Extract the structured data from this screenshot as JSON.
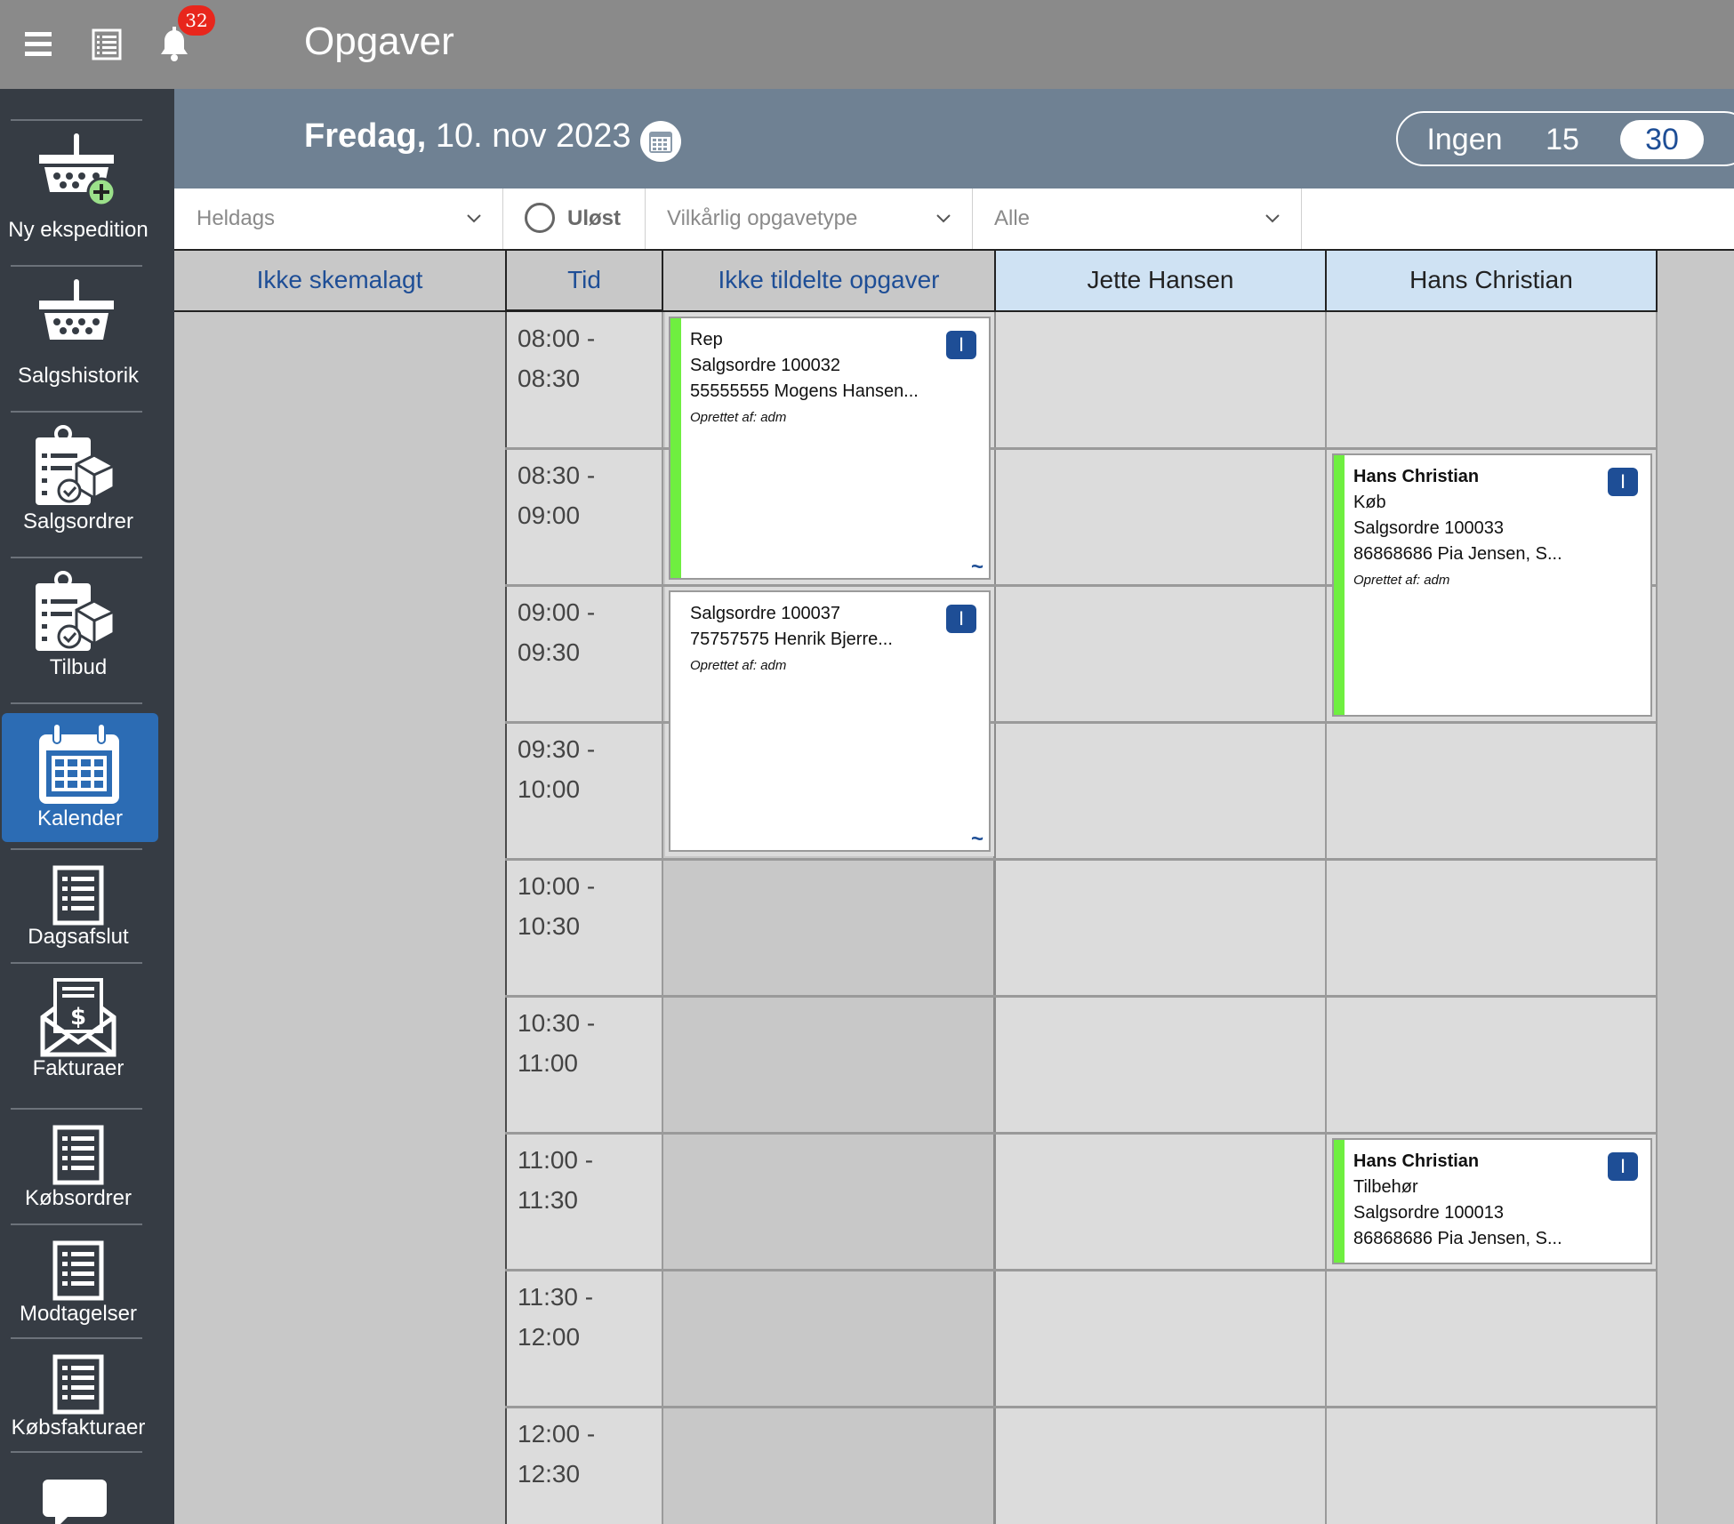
{
  "topbar": {
    "title": "Opgaver",
    "notification_count": "32"
  },
  "sidebar": {
    "items": [
      {
        "label": "Ny ekspedition",
        "icon": "basket-plus-icon"
      },
      {
        "label": "Salgshistorik",
        "icon": "basket-icon"
      },
      {
        "label": "Salgsordrer",
        "icon": "clipboard-box-icon"
      },
      {
        "label": "Tilbud",
        "icon": "clipboard-box-icon"
      },
      {
        "label": "Kalender",
        "icon": "calendar-icon",
        "active": true
      },
      {
        "label": "Dagsafslut",
        "icon": "list-icon"
      },
      {
        "label": "Fakturaer",
        "icon": "invoice-envelope-icon"
      },
      {
        "label": "Købsordrer",
        "icon": "list-icon"
      },
      {
        "label": "Modtagelser",
        "icon": "list-icon"
      },
      {
        "label": "Købsfakturaer",
        "icon": "list-icon"
      }
    ]
  },
  "date_header": {
    "weekday": "Fredag,",
    "date": "10. nov 2023",
    "interval_options": [
      "Ingen",
      "15",
      "30"
    ],
    "interval_selected": "30"
  },
  "filters": {
    "heldags": "Heldags",
    "ulost": "Uløst",
    "task_type": "Vilkårlig opgavetype",
    "alle": "Alle"
  },
  "columns": {
    "ikke_skemalagt": "Ikke skemalagt",
    "tid": "Tid",
    "ikke_tildelte": "Ikke tildelte opgaver",
    "jette": "Jette Hansen",
    "hans": "Hans Christian"
  },
  "time_slots": [
    {
      "start": "08:00 -",
      "end": "08:30"
    },
    {
      "start": "08:30 -",
      "end": "09:00"
    },
    {
      "start": "09:00 -",
      "end": "09:30"
    },
    {
      "start": "09:30 -",
      "end": "10:00"
    },
    {
      "start": "10:00 -",
      "end": "10:30"
    },
    {
      "start": "10:30 -",
      "end": "11:00"
    },
    {
      "start": "11:00 -",
      "end": "11:30"
    },
    {
      "start": "11:30 -",
      "end": "12:00"
    },
    {
      "start": "12:00 -",
      "end": "12:30"
    }
  ],
  "cards": {
    "c1": {
      "line1": "Rep",
      "line2": "Salgsordre 100032",
      "line3": "55555555 Mogens Hansen...",
      "created": "Oprettet af: adm",
      "badge": "I",
      "status_color": "#6fef40"
    },
    "c2": {
      "line1": "Salgsordre 100037",
      "line2": "75757575 Henrik Bjerre...",
      "created": "Oprettet af: adm",
      "badge": "I"
    },
    "c3": {
      "title": "Hans Christian",
      "line1": "Køb",
      "line2": "Salgsordre 100033",
      "line3": "86868686 Pia Jensen, S...",
      "created": "Oprettet af: adm",
      "badge": "I",
      "status_color": "#6fef40"
    },
    "c4": {
      "title": "Hans Christian",
      "line1": "Tilbehør",
      "line2": "Salgsordre 100013",
      "line3": "86868686 Pia Jensen, S...",
      "badge": "I",
      "status_color": "#6fef40"
    }
  },
  "colors": {
    "accent": "#1e4e96",
    "sidebar_bg": "#363c44",
    "active_nav": "#2c6cb4",
    "header_bg": "#6f8193",
    "topbar_bg": "#8a8a8a",
    "badge_red": "#e8261c"
  }
}
